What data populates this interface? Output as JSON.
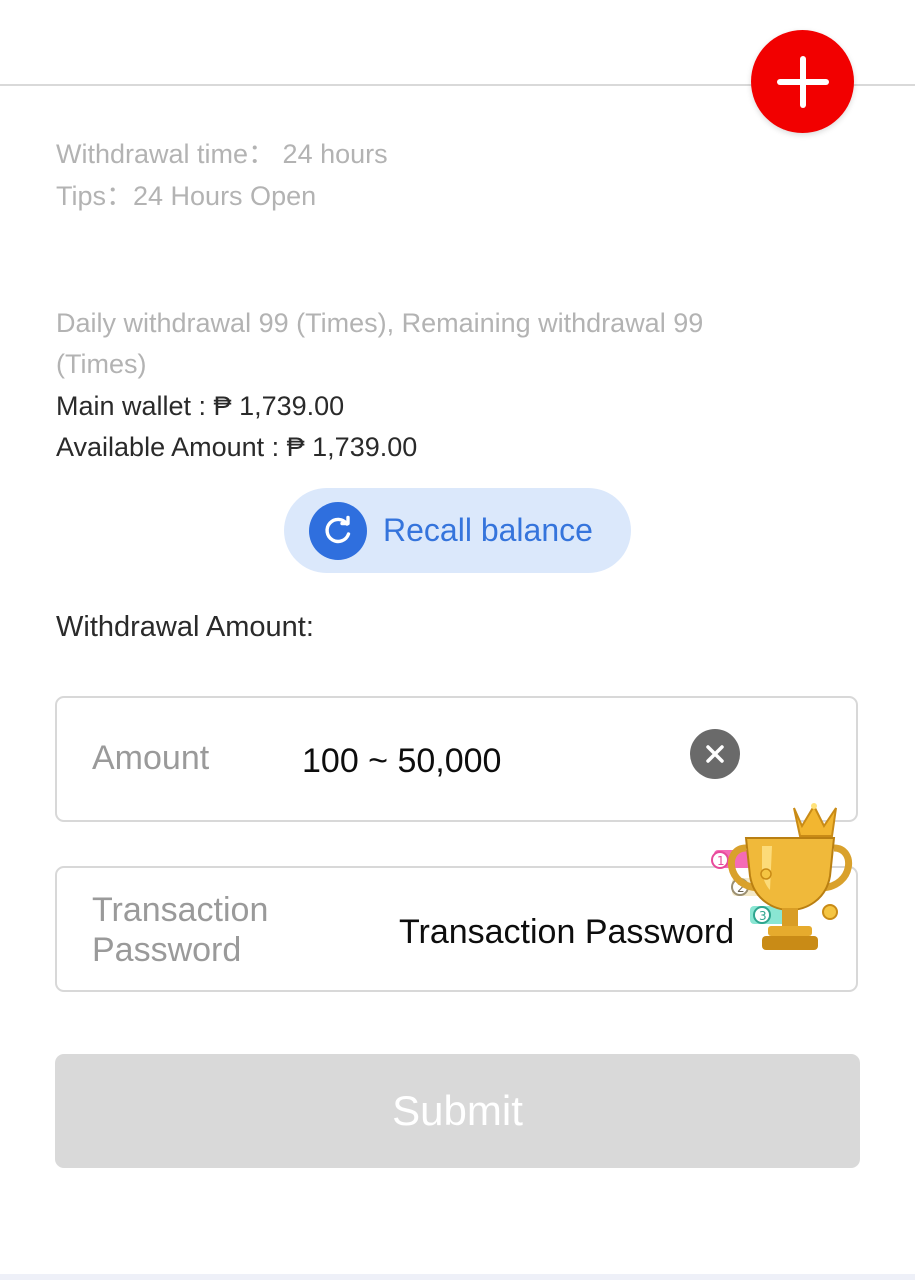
{
  "header": {
    "add_icon": "plus-icon",
    "add_color": "#f20000"
  },
  "info": {
    "withdrawal_time": "Withdrawal time：  24 hours",
    "tips": "Tips：24 Hours Open",
    "daily_limit_line1": "Daily withdrawal 99 (Times), Remaining withdrawal 99",
    "daily_limit_line2": "(Times)",
    "main_wallet": "Main wallet : ₱ 1,739.00",
    "available_amount": "Available Amount : ₱ 1,739.00"
  },
  "recall": {
    "label": "Recall balance",
    "icon": "refresh-icon",
    "color": "#3574dc"
  },
  "form": {
    "section_label": "Withdrawal Amount:",
    "amount": {
      "label": "Amount",
      "placeholder": "100 ~ 50,000",
      "clear_icon": "clear-icon"
    },
    "password": {
      "label_line1": "Transaction",
      "label_line2": "Password",
      "placeholder": "Transaction Password"
    },
    "submit_label": "Submit"
  },
  "overlay": {
    "icon": "trophy-icon"
  }
}
